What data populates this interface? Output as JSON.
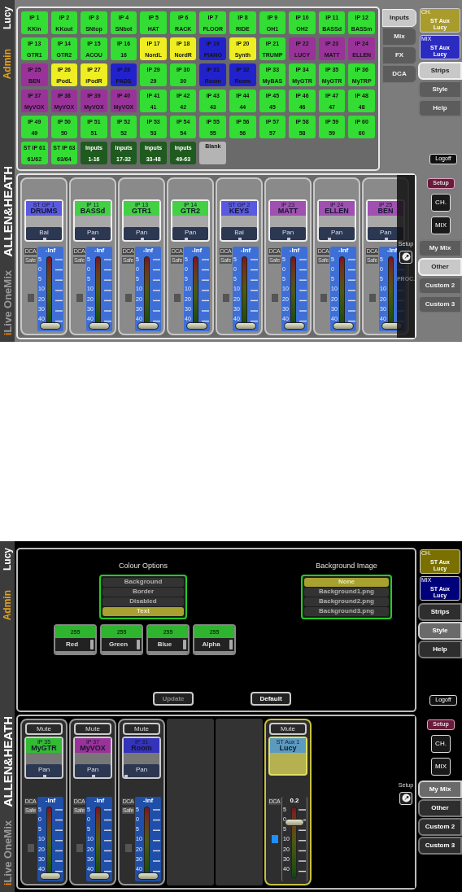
{
  "screens": [
    {
      "user": "Lucy",
      "role": "Admin",
      "brand": "ALLEN&HEATH",
      "product": {
        "prefix": "i",
        "name": "Live OneMix"
      },
      "panel": {
        "kind": "grid",
        "buttons": [
          {
            "kind": "channel",
            "line1": "IP 1",
            "line2": "KKin",
            "color": "#33dd33"
          },
          {
            "kind": "channel",
            "line1": "IP 2",
            "line2": "KKout",
            "color": "#33dd33"
          },
          {
            "kind": "channel",
            "line1": "IP 3",
            "line2": "SNtop",
            "color": "#33dd33"
          },
          {
            "kind": "channel",
            "line1": "IP 4",
            "line2": "SNbot",
            "color": "#33dd33"
          },
          {
            "kind": "channel",
            "line1": "IP 5",
            "line2": "HAT",
            "color": "#33dd33"
          },
          {
            "kind": "channel",
            "line1": "IP 6",
            "line2": "RACK",
            "color": "#33dd33"
          },
          {
            "kind": "channel",
            "line1": "IP 7",
            "line2": "FLOOR",
            "color": "#33dd33"
          },
          {
            "kind": "channel",
            "line1": "IP 8",
            "line2": "RIDE",
            "color": "#33dd33"
          },
          {
            "kind": "channel",
            "line1": "IP 9",
            "line2": "OH1",
            "color": "#33dd33"
          },
          {
            "kind": "channel",
            "line1": "IP 10",
            "line2": "OH2",
            "color": "#33dd33"
          },
          {
            "kind": "channel",
            "line1": "IP 11",
            "line2": "BASSd",
            "color": "#33dd33"
          },
          {
            "kind": "channel",
            "line1": "IP 12",
            "line2": "BASSm",
            "color": "#33dd33"
          },
          {
            "kind": "channel",
            "line1": "IP 13",
            "line2": "GTR1",
            "color": "#33dd33"
          },
          {
            "kind": "channel",
            "line1": "IP 14",
            "line2": "GTR2",
            "color": "#33dd33"
          },
          {
            "kind": "channel",
            "line1": "IP 15",
            "line2": "ACOU",
            "color": "#33dd33"
          },
          {
            "kind": "channel",
            "line1": "IP 16",
            "line2": "16",
            "color": "#33dd33"
          },
          {
            "kind": "channel",
            "line1": "IP 17",
            "line2": "NordL",
            "color": "#eeee22"
          },
          {
            "kind": "channel",
            "line1": "IP 18",
            "line2": "NordR",
            "color": "#eeee22"
          },
          {
            "kind": "channel",
            "line1": "IP 19",
            "line2": "PIANO",
            "color": "#2222cc"
          },
          {
            "kind": "channel",
            "line1": "IP 20",
            "line2": "Synth",
            "color": "#eeee22"
          },
          {
            "kind": "channel",
            "line1": "IP 21",
            "line2": "TRUMP",
            "color": "#33dd33"
          },
          {
            "kind": "channel",
            "line1": "IP 22",
            "line2": "LUCY",
            "color": "#993399"
          },
          {
            "kind": "channel",
            "line1": "IP 23",
            "line2": "MATT",
            "color": "#993399"
          },
          {
            "kind": "channel",
            "line1": "IP 24",
            "line2": "ELLEN",
            "color": "#993399"
          },
          {
            "kind": "channel",
            "line1": "IP 25",
            "line2": "BEN",
            "color": "#993399"
          },
          {
            "kind": "channel",
            "line1": "IP 26",
            "line2": "iPodL",
            "color": "#eeee22"
          },
          {
            "kind": "channel",
            "line1": "IP 27",
            "line2": "iPodR",
            "color": "#eeee22"
          },
          {
            "kind": "channel",
            "line1": "IP 28",
            "line2": "PADS",
            "color": "#2222cc"
          },
          {
            "kind": "channel",
            "line1": "IP 29",
            "line2": "29",
            "color": "#33dd33"
          },
          {
            "kind": "channel",
            "line1": "IP 30",
            "line2": "30",
            "color": "#33dd33"
          },
          {
            "kind": "channel",
            "line1": "IP 31",
            "line2": "Room",
            "color": "#2222cc"
          },
          {
            "kind": "channel",
            "line1": "IP 32",
            "line2": "Room",
            "color": "#2222cc"
          },
          {
            "kind": "channel",
            "line1": "IP 33",
            "line2": "MyBAS",
            "color": "#33dd33"
          },
          {
            "kind": "channel",
            "line1": "IP 34",
            "line2": "MyGTR",
            "color": "#33dd33"
          },
          {
            "kind": "channel",
            "line1": "IP 35",
            "line2": "MyGTR",
            "color": "#33dd33"
          },
          {
            "kind": "channel",
            "line1": "IP 36",
            "line2": "MyTRP",
            "color": "#33dd33"
          },
          {
            "kind": "channel",
            "line1": "IP 37",
            "line2": "MyVOX",
            "color": "#993399"
          },
          {
            "kind": "channel",
            "line1": "IP 38",
            "line2": "MyVOX",
            "color": "#993399"
          },
          {
            "kind": "channel",
            "line1": "IP 39",
            "line2": "MyVOX",
            "color": "#993399"
          },
          {
            "kind": "channel",
            "line1": "IP 40",
            "line2": "MyVOX",
            "color": "#993399"
          },
          {
            "kind": "channel",
            "line1": "IP 41",
            "line2": "41",
            "color": "#33dd33"
          },
          {
            "kind": "channel",
            "line1": "IP 42",
            "line2": "42",
            "color": "#33dd33"
          },
          {
            "kind": "channel",
            "line1": "IP 43",
            "line2": "43",
            "color": "#33dd33"
          },
          {
            "kind": "channel",
            "line1": "IP 44",
            "line2": "44",
            "color": "#33dd33"
          },
          {
            "kind": "channel",
            "line1": "IP 45",
            "line2": "45",
            "color": "#33dd33"
          },
          {
            "kind": "channel",
            "line1": "IP 46",
            "line2": "46",
            "color": "#33dd33"
          },
          {
            "kind": "channel",
            "line1": "IP 47",
            "line2": "47",
            "color": "#33dd33"
          },
          {
            "kind": "channel",
            "line1": "IP 48",
            "line2": "48",
            "color": "#33dd33"
          },
          {
            "kind": "channel",
            "line1": "IP 49",
            "line2": "49",
            "color": "#33dd33"
          },
          {
            "kind": "channel",
            "line1": "IP 50",
            "line2": "50",
            "color": "#33dd33"
          },
          {
            "kind": "channel",
            "line1": "IP 51",
            "line2": "51",
            "color": "#33dd33"
          },
          {
            "kind": "channel",
            "line1": "IP 52",
            "line2": "52",
            "color": "#33dd33"
          },
          {
            "kind": "channel",
            "line1": "IP 53",
            "line2": "53",
            "color": "#33dd33"
          },
          {
            "kind": "channel",
            "line1": "IP 54",
            "line2": "54",
            "color": "#33dd33"
          },
          {
            "kind": "channel",
            "line1": "IP 55",
            "line2": "55",
            "color": "#33dd33"
          },
          {
            "kind": "channel",
            "line1": "IP 56",
            "line2": "56",
            "color": "#33dd33"
          },
          {
            "kind": "channel",
            "line1": "IP 57",
            "line2": "57",
            "color": "#33dd33"
          },
          {
            "kind": "channel",
            "line1": "IP 58",
            "line2": "58",
            "color": "#33dd33"
          },
          {
            "kind": "channel",
            "line1": "IP 59",
            "line2": "59",
            "color": "#33dd33"
          },
          {
            "kind": "channel",
            "line1": "IP 60",
            "line2": "60",
            "color": "#33dd33"
          },
          {
            "kind": "channel",
            "line1": "ST IP 61",
            "line2": "61/62",
            "color": "#33dd33"
          },
          {
            "kind": "channel",
            "line1": "ST IP 63",
            "line2": "63/64",
            "color": "#33dd33"
          },
          {
            "kind": "group",
            "line1": "Inputs",
            "line2": "1-16",
            "color": "#1f5a1f"
          },
          {
            "kind": "group",
            "line1": "Inputs",
            "line2": "17-32",
            "color": "#1f5a1f"
          },
          {
            "kind": "group",
            "line1": "Inputs",
            "line2": "33-48",
            "color": "#1f5a1f"
          },
          {
            "kind": "group",
            "line1": "Inputs",
            "line2": "49-63",
            "color": "#1f5a1f"
          },
          {
            "kind": "blank",
            "line1": "Blank",
            "color": "#b4b4b4"
          }
        ],
        "tabs": [
          {
            "label": "Inputs",
            "selected": true
          },
          {
            "label": "Mix",
            "selected": false
          },
          {
            "label": "FX",
            "selected": false
          },
          {
            "label": "DCA",
            "selected": false
          }
        ]
      },
      "mix_select": [
        {
          "tag": "CH.",
          "line1": "ST Aux",
          "line2": "Lucy",
          "color": "#a99b2c"
        },
        {
          "tag": "MIX",
          "line1": "ST Aux",
          "line2": "Lucy",
          "color": "#2b2bc0"
        }
      ],
      "pages": [
        {
          "label": "Strips",
          "selected": true
        },
        {
          "label": "Style",
          "selected": false
        },
        {
          "label": "Help",
          "selected": false
        }
      ],
      "logoff": "Logoff",
      "setup": "Setup",
      "ch": "CH.",
      "mix": "MIX",
      "layers": [
        {
          "label": "My Mix",
          "selected": false
        },
        {
          "label": "Other",
          "selected": true
        },
        {
          "label": "Custom 2",
          "selected": false
        },
        {
          "label": "Custom 3",
          "selected": false
        }
      ],
      "tools": {
        "setup": "Setup",
        "proc": "PROC.",
        "overlay": true
      },
      "strips": [
        {
          "kind": "channel",
          "top": "ST GP 1",
          "name": "DRUMS",
          "color": "#5a5ae0",
          "pan": {
            "label": "Bal",
            "level": 0.5
          },
          "dca": "DCA",
          "safe": "Safe",
          "safe_on": false,
          "fader": {
            "reading": "-Inf",
            "level": 0
          },
          "scale": [
            "5",
            "0",
            "5",
            "10",
            "20",
            "30",
            "40"
          ]
        },
        {
          "kind": "channel",
          "top": "IP 11",
          "name": "BASSd",
          "color": "#44d044",
          "pan": {
            "label": "Pan",
            "level": 0.5
          },
          "dca": "DCA",
          "safe": "Safe",
          "safe_on": false,
          "fader": {
            "reading": "-Inf",
            "level": 0
          },
          "scale": [
            "5",
            "0",
            "5",
            "10",
            "20",
            "30",
            "40"
          ]
        },
        {
          "kind": "channel",
          "top": "IP 13",
          "name": "GTR1",
          "color": "#44d044",
          "pan": {
            "label": "Pan",
            "level": 0.5
          },
          "dca": "DCA",
          "safe": "Safe",
          "safe_on": false,
          "fader": {
            "reading": "-Inf",
            "level": 0
          },
          "scale": [
            "5",
            "0",
            "5",
            "10",
            "20",
            "30",
            "40"
          ]
        },
        {
          "kind": "channel",
          "top": "IP 14",
          "name": "GTR2",
          "color": "#44d044",
          "pan": {
            "label": "Pan",
            "level": 0.35
          },
          "dca": "DCA",
          "safe": "Safe",
          "safe_on": false,
          "fader": {
            "reading": "-Inf",
            "level": 0
          },
          "scale": [
            "5",
            "0",
            "5",
            "10",
            "20",
            "30",
            "40"
          ]
        },
        {
          "kind": "channel",
          "top": "ST GP 2",
          "name": "KEYS",
          "color": "#5a5ae0",
          "pan": {
            "label": "Bal",
            "level": 0.5
          },
          "dca": "DCA",
          "safe": "Safe",
          "safe_on": false,
          "fader": {
            "reading": "-Inf",
            "level": 0
          },
          "scale": [
            "5",
            "0",
            "5",
            "10",
            "20",
            "30",
            "40"
          ]
        },
        {
          "kind": "channel",
          "top": "IP 23",
          "name": "MATT",
          "color": "#a050b0",
          "pan": {
            "label": "Pan",
            "level": 0.5
          },
          "dca": "DCA",
          "safe": "Safe",
          "safe_on": false,
          "fader": {
            "reading": "-Inf",
            "level": 0
          },
          "scale": [
            "5",
            "0",
            "5",
            "10",
            "20",
            "30",
            "40"
          ]
        },
        {
          "kind": "channel",
          "top": "IP 24",
          "name": "ELLEN",
          "color": "#a050b0",
          "pan": {
            "label": "Pan",
            "level": 0.25
          },
          "dca": "DCA",
          "safe": "Safe",
          "safe_on": false,
          "fader": {
            "reading": "-Inf",
            "level": 0
          },
          "scale": [
            "5",
            "0",
            "5",
            "10",
            "20",
            "30",
            "40"
          ]
        },
        {
          "kind": "channel",
          "top": "IP 25",
          "name": "BEN",
          "color": "#a050b0",
          "pan": {
            "label": "Pan",
            "level": 0.5
          },
          "dca": "DCA",
          "safe": "Safe",
          "safe_on": false,
          "fader": {
            "reading": "-Inf",
            "level": 0
          },
          "scale": [
            "5",
            "0",
            "5",
            "10",
            "20",
            "30",
            "40"
          ]
        }
      ]
    },
    {
      "user": "Lucy",
      "role": "Admin",
      "brand": "ALLEN&HEATH",
      "product": {
        "prefix": "i",
        "name": "Live OneMix"
      },
      "panel": {
        "kind": "style",
        "colour_options": {
          "title": "Colour Options",
          "items": [
            {
              "label": "Background",
              "selected": false
            },
            {
              "label": "Border",
              "selected": false
            },
            {
              "label": "Disabled",
              "selected": false
            },
            {
              "label": "Text",
              "selected": true
            }
          ]
        },
        "background_image": {
          "title": "Background Image",
          "items": [
            {
              "label": "None",
              "selected": true
            },
            {
              "label": "Background1.png",
              "selected": false
            },
            {
              "label": "Background2.png",
              "selected": false
            },
            {
              "label": "Background3.png",
              "selected": false
            }
          ]
        },
        "sliders": [
          {
            "value": "255",
            "label": "Red",
            "level": 1
          },
          {
            "value": "255",
            "label": "Green",
            "level": 1
          },
          {
            "value": "255",
            "label": "Blue",
            "level": 1
          },
          {
            "value": "255",
            "label": "Alpha",
            "level": 1
          }
        ],
        "buttons": [
          {
            "label": "Update",
            "disabled": true
          },
          {
            "label": "Default",
            "disabled": false
          }
        ]
      },
      "mix_select": [
        {
          "tag": "CH.",
          "line1": "ST Aux",
          "line2": "Lucy",
          "color": "#7a7000"
        },
        {
          "tag": "MIX",
          "line1": "ST Aux",
          "line2": "Lucy",
          "color": "#00007a"
        }
      ],
      "pages": [
        {
          "label": "Strips",
          "selected": false
        },
        {
          "label": "Style",
          "selected": true
        },
        {
          "label": "Help",
          "selected": false
        }
      ],
      "logoff": "Logoff",
      "setup": "Setup",
      "ch": "CH.",
      "mix": "MIX",
      "layers": [
        {
          "label": "My Mix",
          "selected": true
        },
        {
          "label": "Other",
          "selected": false
        },
        {
          "label": "Custom 2",
          "selected": false
        },
        {
          "label": "Custom 3",
          "selected": false
        }
      ],
      "tools": {
        "setup": "Setup",
        "overlay": false
      },
      "strips": [
        {
          "kind": "channel",
          "mute": "Mute",
          "top": "IP 35",
          "name": "MyGTR",
          "color": "#33bb33",
          "pan": {
            "label": "Pan",
            "level": 0.5
          },
          "dca": "DCA",
          "safe": "Safe",
          "safe_on": false,
          "fader": {
            "reading": "-Inf",
            "level": 0
          },
          "scale": [
            "5",
            "0",
            "5",
            "10",
            "20",
            "30",
            "40"
          ]
        },
        {
          "kind": "channel",
          "mute": "Mute",
          "top": "IP 37",
          "name": "MyVOX",
          "color": "#993399",
          "pan": {
            "label": "Pan",
            "level": 0.5
          },
          "dca": "DCA",
          "safe": "Safe",
          "safe_on": false,
          "fader": {
            "reading": "-Inf",
            "level": 0
          },
          "scale": [
            "5",
            "0",
            "5",
            "10",
            "20",
            "30",
            "40"
          ]
        },
        {
          "kind": "channel",
          "mute": "Mute",
          "top": "IP 31",
          "name": "Room",
          "color": "#3333bb",
          "pan": {
            "label": "Pan",
            "level": 0.03
          },
          "dca": "DCA",
          "safe": "Safe",
          "safe_on": false,
          "fader": {
            "reading": "-Inf",
            "level": 0
          },
          "scale": [
            "5",
            "0",
            "5",
            "10",
            "20",
            "30",
            "40"
          ]
        },
        {
          "kind": "empty"
        },
        {
          "kind": "empty"
        },
        {
          "kind": "aux",
          "mute": "Mute",
          "top": "ST Aux 1",
          "name": "Lucy",
          "color": "#5b9bc0",
          "dca": "DCA",
          "safe_on": true,
          "fader": {
            "reading": "0.2",
            "level": 0.8
          },
          "scale": [
            "5",
            "0",
            "5",
            "10",
            "20",
            "30",
            "40"
          ]
        }
      ]
    }
  ]
}
